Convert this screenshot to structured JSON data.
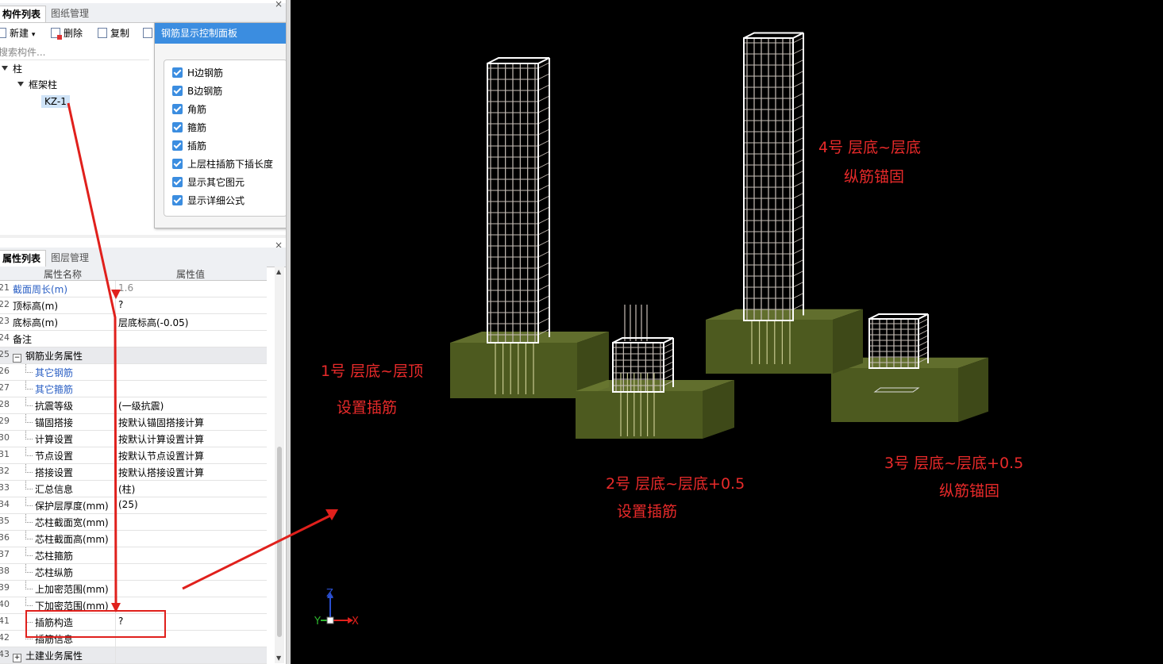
{
  "left_top": {
    "tabs": [
      "构件列表",
      "图纸管理"
    ],
    "toolbar": {
      "new": "新建",
      "new_arrow": "▾",
      "delete": "删除",
      "copy": "复制"
    },
    "search_placeholder": "搜索构件...",
    "tree": [
      {
        "label": "柱"
      },
      {
        "label": "框架柱"
      },
      {
        "label": "KZ-1"
      }
    ],
    "close": "×"
  },
  "popup": {
    "title": "钢筋显示控制面板",
    "options": [
      "H边钢筋",
      "B边钢筋",
      "角筋",
      "箍筋",
      "插筋",
      "上层柱插筋下插长度",
      "显示其它图元",
      "显示详细公式"
    ]
  },
  "props": {
    "tabs": [
      "属性列表",
      "图层管理"
    ],
    "header": {
      "name": "属性名称",
      "value": "属性值"
    },
    "rows": [
      {
        "num": "21",
        "name": "截面周长(m)",
        "value": "1.6"
      },
      {
        "num": "22",
        "name": "顶标高(m)",
        "value": "?"
      },
      {
        "num": "23",
        "name": "底标高(m)",
        "value": "层底标高(-0.05)"
      },
      {
        "num": "24",
        "name": "备注",
        "value": ""
      },
      {
        "num": "25",
        "name": "钢筋业务属性",
        "value": "",
        "toggle": "−"
      },
      {
        "num": "26",
        "name": "其它钢筋",
        "value": ""
      },
      {
        "num": "27",
        "name": "其它箍筋",
        "value": ""
      },
      {
        "num": "28",
        "name": "抗震等级",
        "value": "(一级抗震)"
      },
      {
        "num": "29",
        "name": "锚固搭接",
        "value": "按默认锚固搭接计算"
      },
      {
        "num": "30",
        "name": "计算设置",
        "value": "按默认计算设置计算"
      },
      {
        "num": "31",
        "name": "节点设置",
        "value": "按默认节点设置计算"
      },
      {
        "num": "32",
        "name": "搭接设置",
        "value": "按默认搭接设置计算"
      },
      {
        "num": "33",
        "name": "汇总信息",
        "value": "(柱)"
      },
      {
        "num": "34",
        "name": "保护层厚度(mm)",
        "value": "(25)"
      },
      {
        "num": "35",
        "name": "芯柱截面宽(mm)",
        "value": ""
      },
      {
        "num": "36",
        "name": "芯柱截面高(mm)",
        "value": ""
      },
      {
        "num": "37",
        "name": "芯柱箍筋",
        "value": ""
      },
      {
        "num": "38",
        "name": "芯柱纵筋",
        "value": ""
      },
      {
        "num": "39",
        "name": "上加密范围(mm)",
        "value": ""
      },
      {
        "num": "40",
        "name": "下加密范围(mm)",
        "value": ""
      },
      {
        "num": "41",
        "name": "插筋构造",
        "value": "?"
      },
      {
        "num": "42",
        "name": "插筋信息",
        "value": ""
      },
      {
        "num": "43",
        "name": "土建业务属性",
        "value": "",
        "toggle": "+"
      }
    ]
  },
  "viewport": {
    "annotations": [
      {
        "line1": "1号 层底~层顶",
        "line2": "设置插筋"
      },
      {
        "line1": "2号 层底~层底+0.5",
        "line2": "设置插筋"
      },
      {
        "line1": "3号 层底~层底+0.5",
        "line2": "纵筋锚固"
      },
      {
        "line1": "4号 层底~层底",
        "line2": "纵筋锚固"
      }
    ],
    "axis": {
      "x": "X",
      "y": "Y",
      "z": "Z"
    }
  },
  "colors": {
    "annotation": "#e82a2a",
    "arrow": "#e0201c",
    "footing": "#4d5a1f",
    "rebar": "#c8bfb8",
    "accent": "#3b8de0"
  }
}
